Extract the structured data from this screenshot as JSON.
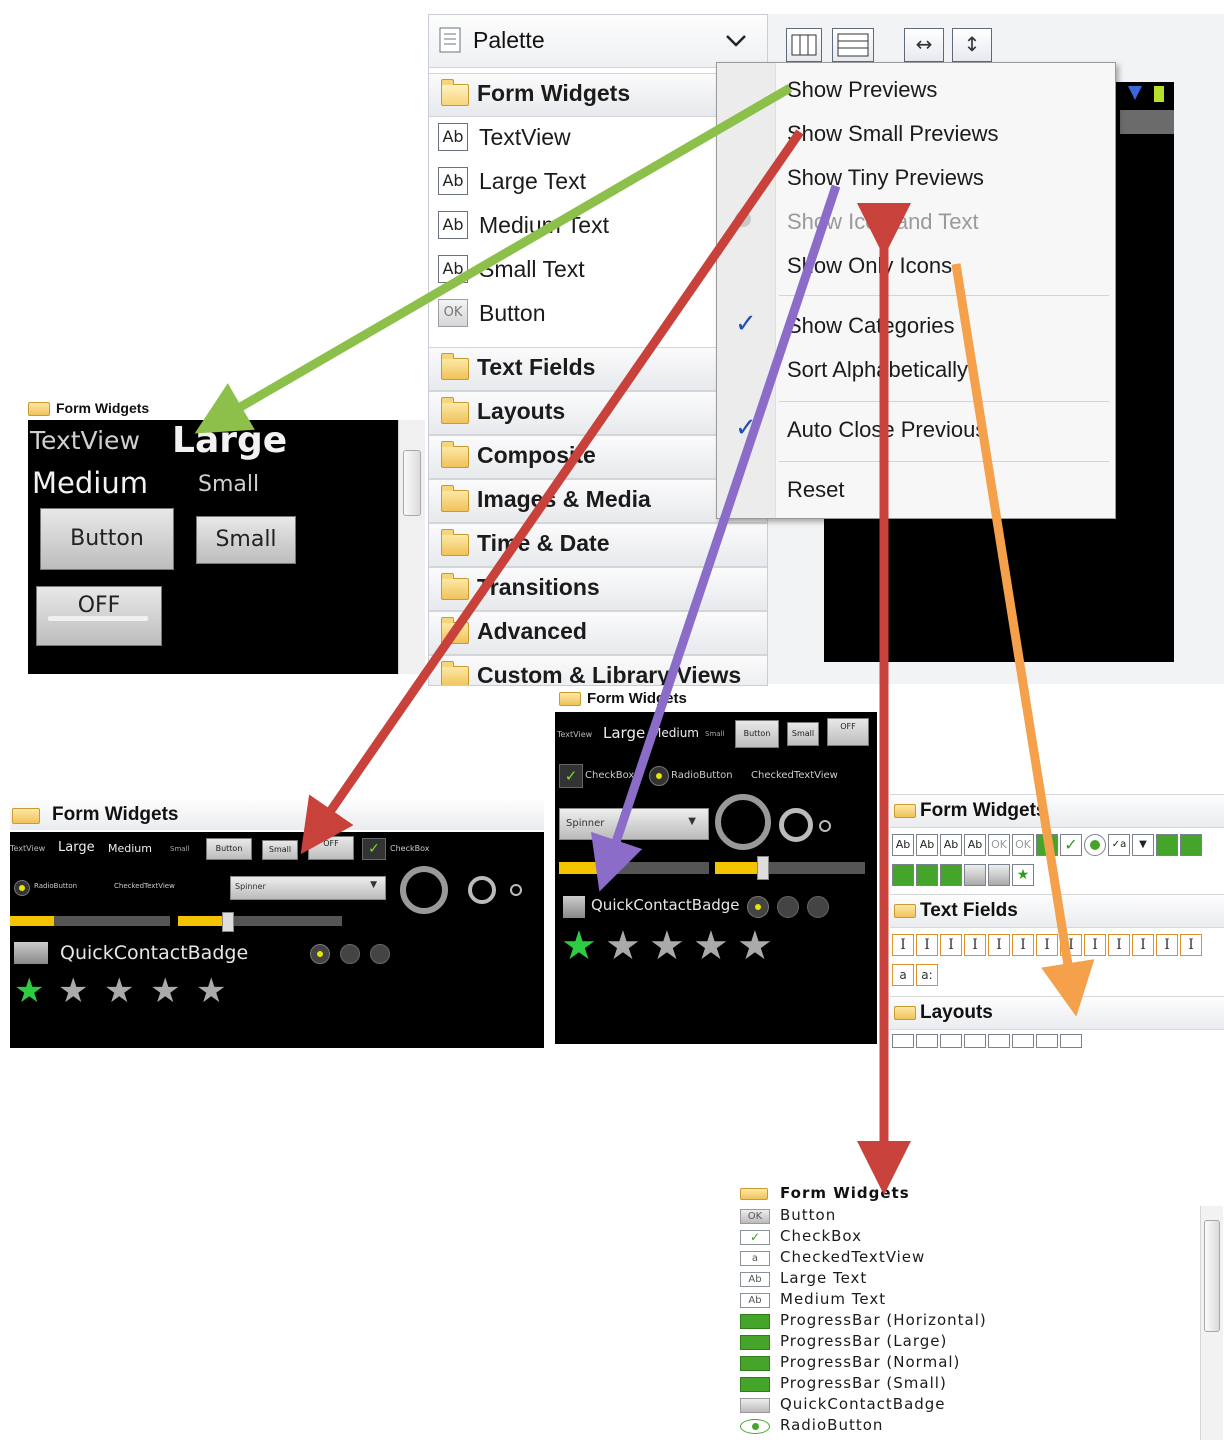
{
  "palette": {
    "title": "Palette",
    "categories": [
      "Form Widgets",
      "Text Fields",
      "Layouts",
      "Composite",
      "Images & Media",
      "Time & Date",
      "Transitions",
      "Advanced",
      "Custom & Library Views"
    ],
    "form_items": [
      {
        "icon": "Ab",
        "label": "TextView"
      },
      {
        "icon": "Ab",
        "label": "Large Text"
      },
      {
        "icon": "Ab",
        "label": "Medium Text"
      },
      {
        "icon": "Ab",
        "label": "Small Text"
      },
      {
        "icon": "OK",
        "label": "Button"
      }
    ]
  },
  "menu": {
    "items": [
      {
        "label": "Show Previews",
        "checked": false,
        "disabled": false
      },
      {
        "label": "Show Small Previews",
        "checked": false,
        "disabled": false
      },
      {
        "label": "Show Tiny Previews",
        "checked": false,
        "disabled": false
      },
      {
        "label": "Show Icon and Text",
        "checked": false,
        "disabled": true
      },
      {
        "label": "Show Only Icons",
        "checked": false,
        "disabled": false
      },
      {
        "label": "Show Categories",
        "checked": true,
        "disabled": false
      },
      {
        "label": "Sort Alphabetically",
        "checked": false,
        "disabled": false
      },
      {
        "label": "Auto Close Previous",
        "checked": true,
        "disabled": false
      },
      {
        "label": "Reset",
        "checked": false,
        "disabled": false
      }
    ]
  },
  "previews": {
    "large": {
      "header": "Form Widgets",
      "textview": "TextView",
      "large": "Large",
      "medium": "Medium",
      "small": "Small",
      "button": "Button",
      "small_button": "Small",
      "toggle": "OFF"
    },
    "small": {
      "header": "Form Widgets",
      "textview": "TextView",
      "large": "Large",
      "medium": "Medium",
      "small": "Small",
      "button": "Button",
      "small_button": "Small",
      "toggle": "OFF",
      "checkbox": "CheckBox",
      "radio": "RadioButton",
      "checked_tv": "CheckedTextView",
      "spinner": "Spinner",
      "badge": "QuickContactBadge"
    },
    "tiny": {
      "header": "Form Widgets",
      "textview": "TextView",
      "large": "Large",
      "medium": "Medium",
      "small": "Small",
      "button": "Button",
      "small_button": "Small",
      "toggle": "OFF",
      "checkbox": "CheckBox",
      "radio": "RadioButton",
      "checked_tv": "CheckedTextView",
      "spinner": "Spinner",
      "badge": "QuickContactBadge"
    },
    "icons_only": {
      "headers": [
        "Form Widgets",
        "Text Fields",
        "Layouts"
      ],
      "form_icons": [
        "Ab",
        "Ab",
        "Ab",
        "Ab",
        "OK",
        "OK"
      ],
      "text_glyph": "I",
      "text_extra": [
        "a",
        "a:"
      ]
    },
    "icon_text": {
      "header": "Form Widgets",
      "items": [
        {
          "icon": "OK",
          "label": "Button"
        },
        {
          "icon": "check",
          "label": "CheckBox"
        },
        {
          "icon": "a",
          "label": "CheckedTextView"
        },
        {
          "icon": "Ab",
          "label": "Large Text"
        },
        {
          "icon": "Ab",
          "label": "Medium Text"
        },
        {
          "icon": "bar",
          "label": "ProgressBar (Horizontal)"
        },
        {
          "icon": "bar",
          "label": "ProgressBar (Large)"
        },
        {
          "icon": "bar",
          "label": "ProgressBar (Normal)"
        },
        {
          "icon": "bar",
          "label": "ProgressBar (Small)"
        },
        {
          "icon": "badge",
          "label": "QuickContactBadge"
        },
        {
          "icon": "radio",
          "label": "RadioButton"
        }
      ]
    }
  },
  "colors": {
    "arrow_green": "#8dc04a",
    "arrow_red": "#c8413a",
    "arrow_purple": "#8b6cc9",
    "arrow_orange": "#f5a04a",
    "check_blue": "#1f4fb5",
    "android_yellow": "#f5c400",
    "star_green": "#2ecc40"
  }
}
